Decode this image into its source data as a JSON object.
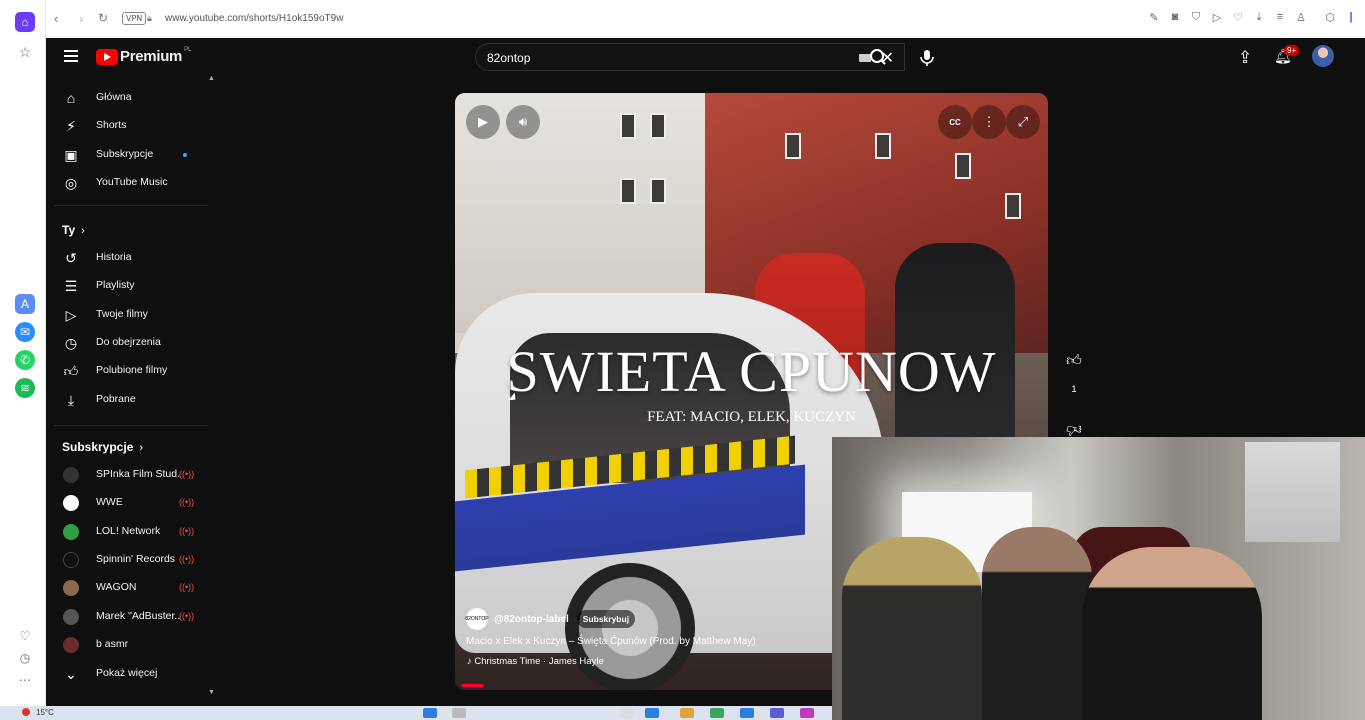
{
  "browser": {
    "url": "www.youtube.com/shorts/H1ok159oT9w",
    "vpn_label": "VPN",
    "back_icon": "chevron-left-icon",
    "forward_icon": "chevron-right-icon",
    "reload_icon": "reload-icon"
  },
  "header": {
    "logo_text": "Premium",
    "logo_region": "PL",
    "search_query": "82ontop",
    "notification_count": "9+"
  },
  "sidebar": {
    "main_items": [
      {
        "label": "Główna",
        "icon": "home-icon"
      },
      {
        "label": "Shorts",
        "icon": "shorts-icon"
      },
      {
        "label": "Subskrypcje",
        "icon": "subscriptions-icon"
      },
      {
        "label": "YouTube Music",
        "icon": "music-icon"
      }
    ],
    "you_section": {
      "title": "Ty",
      "items": [
        {
          "label": "Historia",
          "icon": "history-icon"
        },
        {
          "label": "Playlisty",
          "icon": "playlist-icon"
        },
        {
          "label": "Twoje filmy",
          "icon": "your-videos-icon"
        },
        {
          "label": "Do obejrzenia",
          "icon": "watch-later-icon"
        },
        {
          "label": "Polubione filmy",
          "icon": "liked-icon"
        },
        {
          "label": "Pobrane",
          "icon": "download-icon"
        }
      ]
    },
    "subs_section": {
      "title": "Subskrypcje",
      "items": [
        {
          "label": "SPInka Film Stud...",
          "color": "#333333"
        },
        {
          "label": "WWE",
          "color": "#ffffff"
        },
        {
          "label": "LOL! Network",
          "color": "#2f9e44"
        },
        {
          "label": "Spinnin' Records",
          "color": "#111111"
        },
        {
          "label": "WAGON",
          "color": "#8a6a4a"
        },
        {
          "label": "Marek \"AdBuster...",
          "color": "#555555"
        },
        {
          "label": "b asmr",
          "color": "#6b2c2c"
        }
      ],
      "show_more": "Pokaż więcej"
    }
  },
  "short": {
    "title_text": "SWIETA CPUNOW",
    "subtitle_text": "FEAT: MACIO, ELEK, KUCZYN",
    "channel": "@82ontop-label",
    "channel_avatar_text": "82ONTOP",
    "subscribe_label": "Subskrybuj",
    "description": "Macio x Elek x Kuczyn – Święta Ćpunów (Prod. by Matthew May)",
    "music": "Christmas Time · James Hayle",
    "like_count": "1",
    "progress_fraction": 0.04
  },
  "colors": {
    "accent": "#ff0000",
    "background": "#0f0f0f",
    "link_blue": "#3ea6ff",
    "live_red": "#ff4e45"
  },
  "taskbar": {
    "weather": "15°C"
  }
}
